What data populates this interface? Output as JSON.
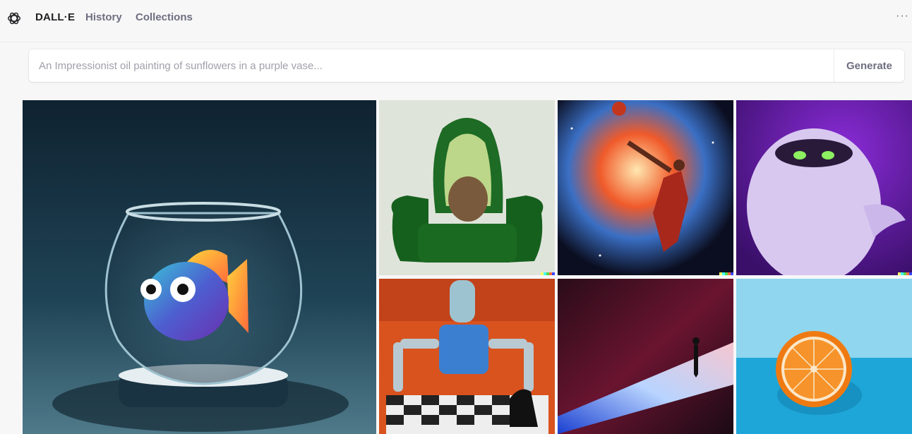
{
  "nav": {
    "brand": "DALL·E",
    "history": "History",
    "collections": "Collections",
    "more": "···"
  },
  "prompt": {
    "placeholder": "An Impressionist oil painting of sunflowers in a purple vase...",
    "value": "",
    "generate_label": "Generate"
  },
  "gallery": {
    "images": [
      {
        "subject": "fish-in-bowl-image"
      },
      {
        "subject": "avocado-armchair-image"
      },
      {
        "subject": "space-basketball-painting-image"
      },
      {
        "subject": "purple-furry-monster-image"
      },
      {
        "subject": "robot-chess-painting-image"
      },
      {
        "subject": "silhouette-light-image"
      },
      {
        "subject": "orange-half-image"
      }
    ]
  },
  "colors": {
    "background": "#f7f7f8",
    "text": "#202123",
    "muted": "#6e6e80"
  }
}
